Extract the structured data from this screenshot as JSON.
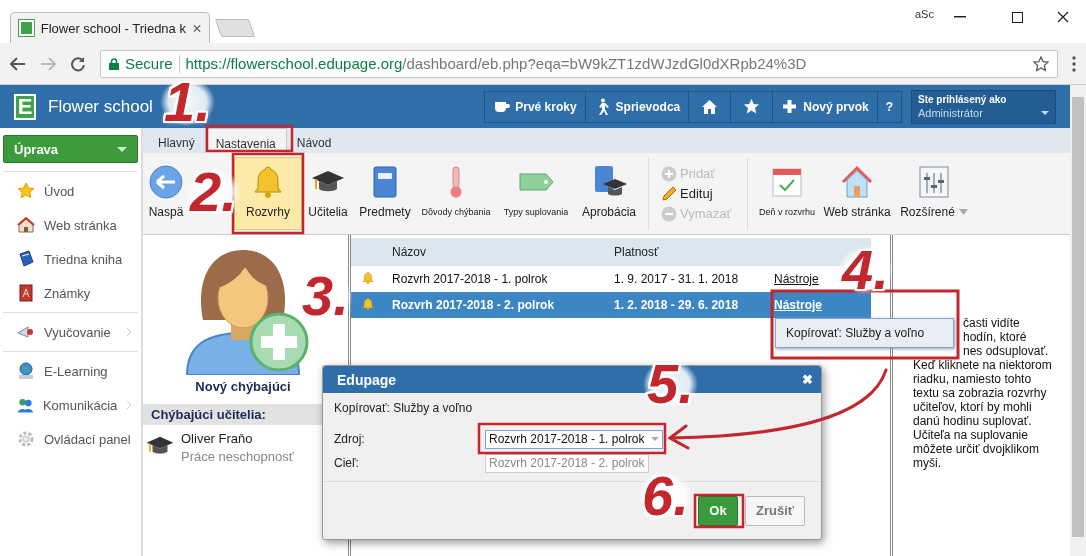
{
  "browser": {
    "tab_title": "Flower school - Triedna k",
    "badge": "aSc",
    "secure_label": "Secure",
    "url_host": "https://flowerschool.edupage.org",
    "url_path": "/dashboard/eb.php?eqa=bW9kZT1zdWJzdGl0dXRpb24%3D"
  },
  "header": {
    "logo_letter": "E",
    "title": "Flower school",
    "buttons": [
      {
        "kind": "text",
        "label": "Prvé kroky"
      },
      {
        "kind": "text",
        "label": "Sprievodca"
      },
      {
        "kind": "icon"
      },
      {
        "kind": "icon"
      },
      {
        "kind": "text",
        "label": "Nový prvok"
      },
      {
        "kind": "text",
        "label": "?"
      }
    ],
    "user": {
      "caption": "Ste prihlásený ako",
      "name": "Administrátor"
    }
  },
  "sidebar": {
    "menu_button": "Úprava",
    "groups": [
      {
        "items": [
          {
            "label": "Úvod",
            "submenu": false
          },
          {
            "label": "Web stránka",
            "submenu": false
          },
          {
            "label": "Triedna kniha",
            "submenu": false
          },
          {
            "label": "Známky",
            "submenu": false
          }
        ]
      },
      {
        "items": [
          {
            "label": "Vyučovanie",
            "submenu": true
          }
        ]
      },
      {
        "items": [
          {
            "label": "E-Learning",
            "submenu": false
          },
          {
            "label": "Komunikácia",
            "submenu": true
          },
          {
            "label": "Ovládací panel",
            "submenu": false
          }
        ]
      }
    ]
  },
  "tabs": [
    {
      "label": "Hlavný",
      "selected": false
    },
    {
      "label": "Nastavenia",
      "selected": true
    },
    {
      "label": "Návod",
      "selected": false
    }
  ],
  "ribbon": {
    "groups": [
      {
        "kind": "large",
        "items": [
          {
            "label": "Naspä",
            "compact": false,
            "selected": false,
            "dropdown": false
          },
          {
            "label": "Rozvrhy",
            "compact": false,
            "selected": true,
            "dropdown": false
          },
          {
            "label": "Učitelia",
            "compact": false,
            "selected": false,
            "dropdown": false
          },
          {
            "label": "Predmety",
            "compact": false,
            "selected": false,
            "dropdown": false
          },
          {
            "label": "Dôvody chýbania",
            "compact": true,
            "selected": false,
            "dropdown": false
          },
          {
            "label": "Typy suplovania",
            "compact": true,
            "selected": false,
            "dropdown": false
          },
          {
            "label": "Aprobácia",
            "compact": false,
            "selected": false,
            "dropdown": false
          }
        ]
      },
      {
        "kind": "list",
        "items": [
          {
            "label": "Pridať",
            "disabled": true
          },
          {
            "label": "Edituj",
            "disabled": false
          },
          {
            "label": "Vymazať",
            "disabled": true
          }
        ]
      },
      {
        "kind": "large",
        "items": [
          {
            "label": "Deň v rozvrhu",
            "compact": true,
            "selected": false,
            "dropdown": false
          },
          {
            "label": "Web stránka",
            "compact": false,
            "selected": false,
            "dropdown": false
          },
          {
            "label": "Rozšírené",
            "compact": false,
            "selected": false,
            "dropdown": true
          }
        ]
      }
    ]
  },
  "absentees": {
    "new_label": "Nový chýbajúci",
    "heading": "Chýbajúci učitelia:",
    "teachers": [
      {
        "name": "Oliver Fraňo",
        "reason": "Práce neschopnosť"
      }
    ]
  },
  "timetables": {
    "columns": [
      "Názov",
      "Platnosť"
    ],
    "rows": [
      {
        "name": "Rozvrh 2017-2018 - 1. polrok",
        "validity": "1. 9. 2017 - 31. 1. 2018",
        "action": "Nástroje",
        "selected": false
      },
      {
        "name": "Rozvrh 2017-2018 - 2. polrok",
        "validity": "1. 2. 2018 - 29. 6. 2018",
        "action": "Nástroje",
        "selected": true
      }
    ]
  },
  "context_menu": {
    "items": [
      "Kopírovať: Služby a voľno"
    ]
  },
  "help_text": {
    "fragments": [
      "časti vidíte",
      "hodín, ktoré",
      "nes odsuplovať."
    ],
    "paragraph": "Keď kliknete na niektorom riadku, namiesto tohto textu sa zobrazia rozvrhy učiteľov, ktorí by mohli danú hodinu suplovať. Učiteľa na suplovanie môžete určiť dvojklikom myši."
  },
  "dialog": {
    "title": "Edupage",
    "close": "✖",
    "subtitle": "Kopírovať: Služby a voľno",
    "fields": [
      {
        "label": "Zdroj:",
        "value": "Rozvrh 2017-2018 - 1. polrok",
        "kind": "select",
        "disabled": false
      },
      {
        "label": "Cieľ:",
        "value": "Rozvrh 2017-2018 - 2. polrok",
        "kind": "text",
        "disabled": true
      }
    ],
    "buttons": [
      {
        "label": "Ok",
        "kind": "primary"
      },
      {
        "label": "Zrušiť",
        "kind": "secondary"
      }
    ]
  },
  "annotations": [
    {
      "text": "1."
    },
    {
      "text": "2."
    },
    {
      "text": "3."
    },
    {
      "text": "4."
    },
    {
      "text": "5."
    },
    {
      "text": "6."
    }
  ]
}
